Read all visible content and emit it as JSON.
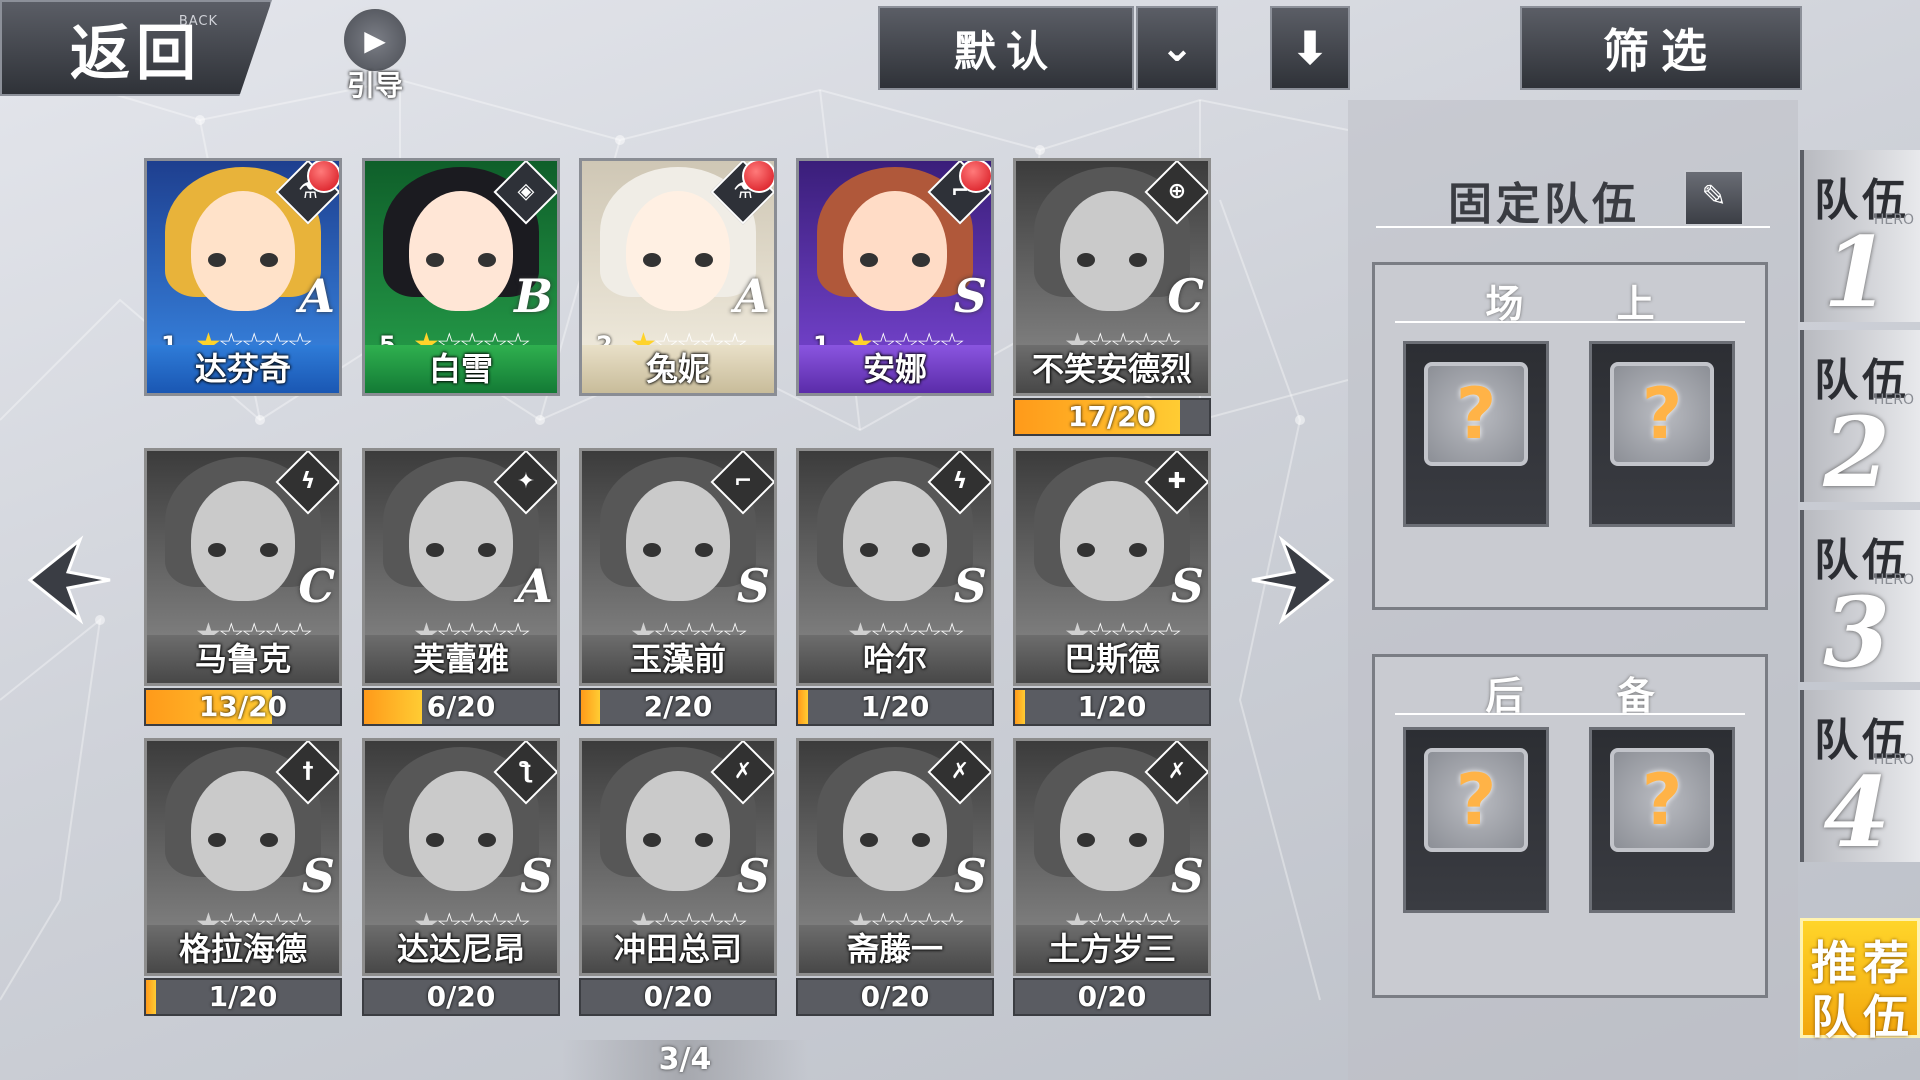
{
  "header": {
    "back_label": "返回",
    "back_sub": "BACK",
    "guide_label": "引导",
    "sort_label": "默认",
    "filter_label": "筛选"
  },
  "roster": {
    "page": "3/4",
    "cards": [
      {
        "name": "达芬奇",
        "level": "1",
        "stars": 1,
        "rank": "A",
        "style": "blue",
        "class_icon": "flask-icon",
        "class_glyph": "⚗",
        "new": true,
        "progress": null
      },
      {
        "name": "白雪",
        "level": "5",
        "stars": 1,
        "rank": "B",
        "style": "green",
        "class_icon": "shield-icon",
        "class_glyph": "◈",
        "new": false,
        "progress": null
      },
      {
        "name": "兔妮",
        "level": "2",
        "stars": 1,
        "rank": "A",
        "style": "white",
        "class_icon": "flask-icon",
        "class_glyph": "⚗",
        "new": true,
        "progress": null
      },
      {
        "name": "安娜",
        "level": "1",
        "stars": 1,
        "rank": "S",
        "style": "purple",
        "class_icon": "gun-icon",
        "class_glyph": "⌐",
        "new": true,
        "progress": null
      },
      {
        "name": "不笑安德烈",
        "level": "",
        "stars": 1,
        "rank": "C",
        "style": "gray",
        "class_icon": "crosshair-icon",
        "class_glyph": "⊕",
        "new": false,
        "progress": "17/20",
        "fill": 0.85
      },
      {
        "name": "马鲁克",
        "level": "",
        "stars": 1,
        "rank": "C",
        "style": "gray",
        "class_icon": "lightning-icon",
        "class_glyph": "ϟ",
        "new": false,
        "progress": "13/20",
        "fill": 0.65
      },
      {
        "name": "芙蕾雅",
        "level": "",
        "stars": 1,
        "rank": "A",
        "style": "gray",
        "class_icon": "mask-icon",
        "class_glyph": "✦",
        "new": false,
        "progress": "6/20",
        "fill": 0.3
      },
      {
        "name": "玉藻前",
        "level": "",
        "stars": 1,
        "rank": "S",
        "style": "gray",
        "class_icon": "gun-icon",
        "class_glyph": "⌐",
        "new": false,
        "progress": "2/20",
        "fill": 0.1
      },
      {
        "name": "哈尔",
        "level": "",
        "stars": 1,
        "rank": "S",
        "style": "gray",
        "class_icon": "lightning-icon",
        "class_glyph": "ϟ",
        "new": false,
        "progress": "1/20",
        "fill": 0.05
      },
      {
        "name": "巴斯德",
        "level": "",
        "stars": 1,
        "rank": "S",
        "style": "gray",
        "class_icon": "cross-icon",
        "class_glyph": "✚",
        "new": false,
        "progress": "1/20",
        "fill": 0.05
      },
      {
        "name": "格拉海德",
        "level": "",
        "stars": 1,
        "rank": "S",
        "style": "gray",
        "class_icon": "sword-icon",
        "class_glyph": "†",
        "new": false,
        "progress": "1/20",
        "fill": 0.05
      },
      {
        "name": "达达尼昂",
        "level": "",
        "stars": 1,
        "rank": "S",
        "style": "gray",
        "class_icon": "rapier-icon",
        "class_glyph": "ƪ",
        "new": false,
        "progress": "0/20",
        "fill": 0
      },
      {
        "name": "冲田总司",
        "level": "",
        "stars": 1,
        "rank": "S",
        "style": "gray",
        "class_icon": "katana-icon",
        "class_glyph": "✗",
        "new": false,
        "progress": "0/20",
        "fill": 0
      },
      {
        "name": "斋藤一",
        "level": "",
        "stars": 1,
        "rank": "S",
        "style": "gray",
        "class_icon": "katana-icon",
        "class_glyph": "✗",
        "new": false,
        "progress": "0/20",
        "fill": 0
      },
      {
        "name": "土方岁三",
        "level": "",
        "stars": 1,
        "rank": "S",
        "style": "gray",
        "class_icon": "katana-icon",
        "class_glyph": "✗",
        "new": false,
        "progress": "0/20",
        "fill": 0
      }
    ]
  },
  "team": {
    "title": "固定队伍",
    "onfield_label": "场 上",
    "reserve_label": "后 备",
    "slot_placeholder": "?"
  },
  "tabs": [
    {
      "label": "队伍",
      "num": "1"
    },
    {
      "label": "队伍",
      "num": "2"
    },
    {
      "label": "队伍",
      "num": "3"
    },
    {
      "label": "队伍",
      "num": "4"
    }
  ],
  "tab_sub": "HERO",
  "recommend": {
    "line1": "推荐",
    "line2": "队伍"
  },
  "colors": {
    "progress": "#ff9a1a",
    "badge": "#d4101a",
    "recommend": "#ffd52a"
  }
}
